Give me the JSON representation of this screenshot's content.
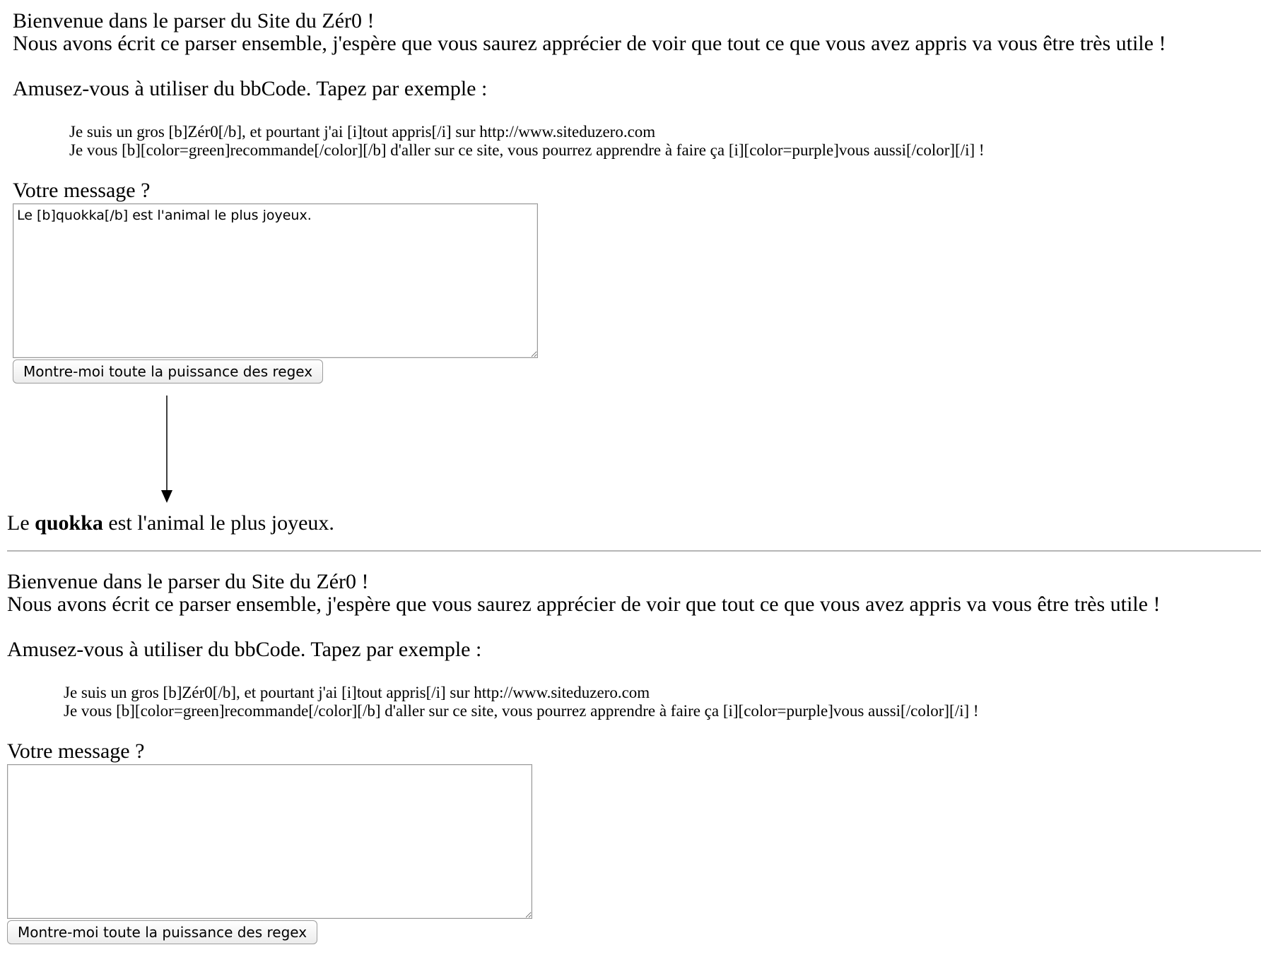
{
  "form": {
    "intro_line1": "Bienvenue dans le parser du Site du Zér0 !",
    "intro_line2": "Nous avons écrit ce parser ensemble, j'espère que vous saurez apprécier de voir que tout ce que vous avez appris va vous être très utile !",
    "prompt": "Amusez-vous à utiliser du bbCode. Tapez par exemple :",
    "example_line1": "Je suis un gros [b]Zér0[/b], et pourtant j'ai [i]tout appris[/i] sur http://www.siteduzero.com",
    "example_line2": "Je vous [b][color=green]recommande[/color][/b] d'aller sur ce site, vous pourrez apprendre à faire ça [i][color=purple]vous aussi[/color][/i] !",
    "message_label": "Votre message ?",
    "submit_label": "Montre-moi toute la puissance des regex"
  },
  "top_form": {
    "message_value": "Le [b]quokka[/b] est l'animal le plus joyeux."
  },
  "bottom_form": {
    "message_value": ""
  },
  "output": {
    "before": "Le ",
    "bold": "quokka",
    "after": " est l'animal le plus joyeux."
  },
  "arrow_icon": "down-arrow-icon"
}
